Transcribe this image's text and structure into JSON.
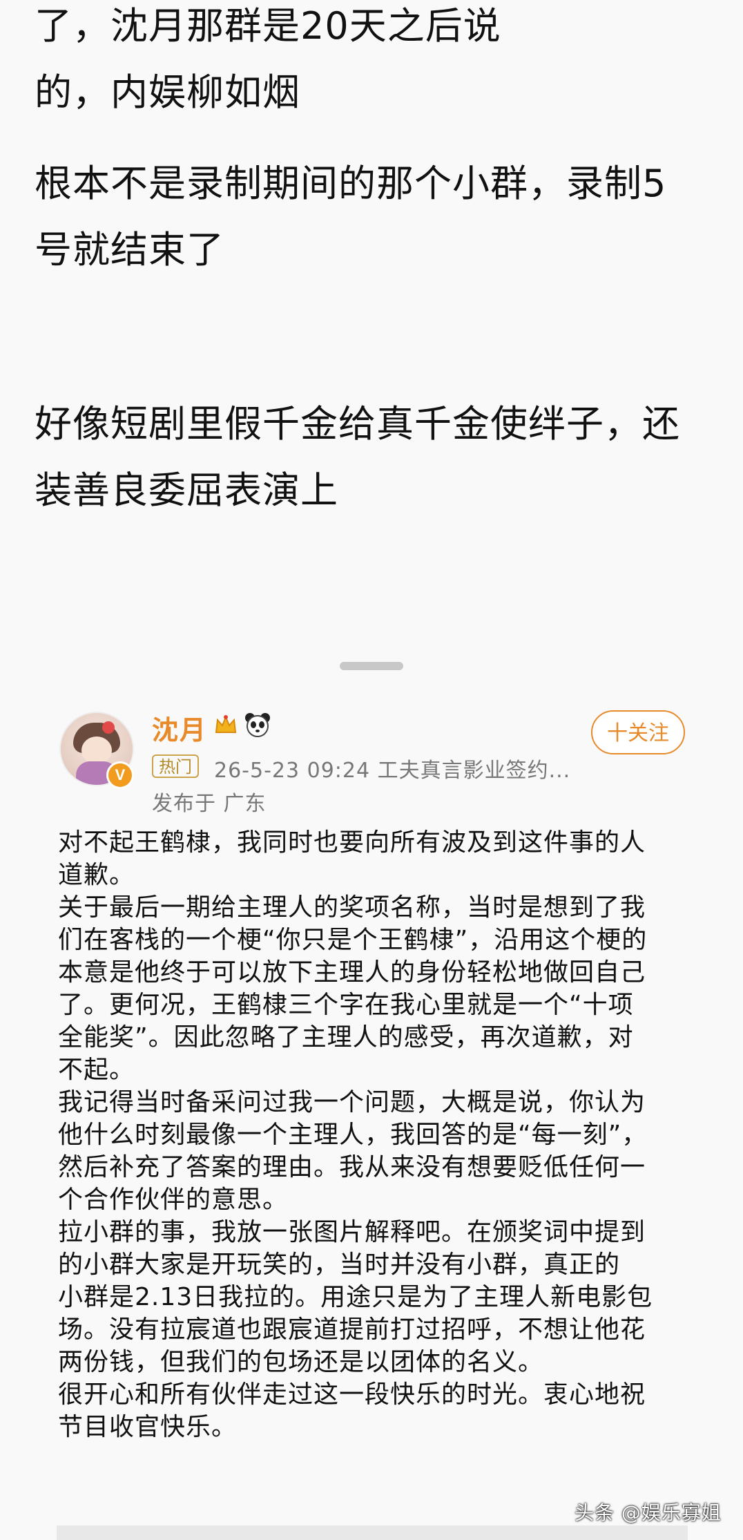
{
  "upper_text": {
    "para1": "了，沈月那群是20天之后说\n的，内娱柳如烟",
    "para2": "根本不是录制期间的那个小群，录制5\n号就结束了",
    "para3": "好像短剧里假千金给真千金使绊子，还\n装善良委屈表演上"
  },
  "post": {
    "author": "沈月",
    "verified_badge": "V",
    "crown_icon": "crown-icon",
    "panda_icon": "panda-icon",
    "follow_label": "十关注",
    "hot_tag": "热门",
    "meta": "26-5-23 09:24  工夫真言影业签约...",
    "location": "发布于 广东",
    "body": "对不起王鹤棣，我同时也要向所有波及到这件事的人\n道歉。\n关于最后一期给主理人的奖项名称，当时是想到了我\n们在客栈的一个梗“你只是个王鹤棣”，沿用这个梗的\n本意是他终于可以放下主理人的身份轻松地做回自己\n了。更何况，王鹤棣三个字在我心里就是一个“十项\n全能奖”。因此忽略了主理人的感受，再次道歉，对\n不起。\n我记得当时备采问过我一个问题，大概是说，你认为\n他什么时刻最像一个主理人，我回答的是“每一刻”，\n然后补充了答案的理由。我从来没有想要贬低任何一\n个合作伙伴的意思。\n拉小群的事，我放一张图片解释吧。在颁奖词中提到\n的小群大家是开玩笑的，当时并没有小群，真正的\n小群是2.13日我拉的。用途只是为了主理人新电影包\n场。没有拉宸道也跟宸道提前打过招呼，不想让他花\n两份钱，但我们的包场还是以团体的名义。\n很开心和所有伙伴走过这一段快乐的时光。衷心地祝\n节目收官快乐。"
  },
  "watermark": "头条 @娱乐寡姐",
  "colors": {
    "accent": "#e8892a",
    "background": "#f9f9f9",
    "meta_text": "#777777"
  }
}
